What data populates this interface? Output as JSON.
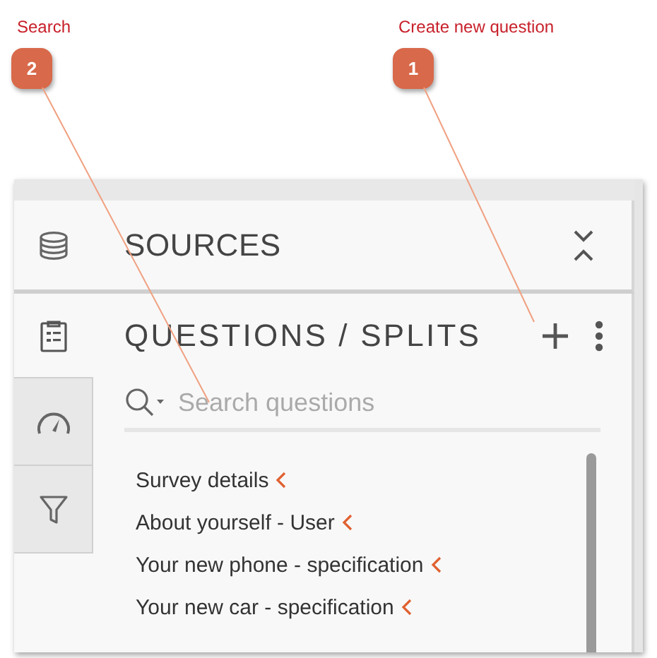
{
  "callouts": [
    {
      "number": "2",
      "label": "Search"
    },
    {
      "number": "1",
      "label": "Create new question"
    }
  ],
  "sources": {
    "title": "SOURCES"
  },
  "questions": {
    "title": "QUESTIONS / SPLITS",
    "search": {
      "placeholder": "Search questions"
    },
    "items": [
      {
        "label": "Survey details"
      },
      {
        "label": "About yourself - User"
      },
      {
        "label": "Your new phone - specification"
      },
      {
        "label": "Your new car - specification"
      }
    ]
  }
}
